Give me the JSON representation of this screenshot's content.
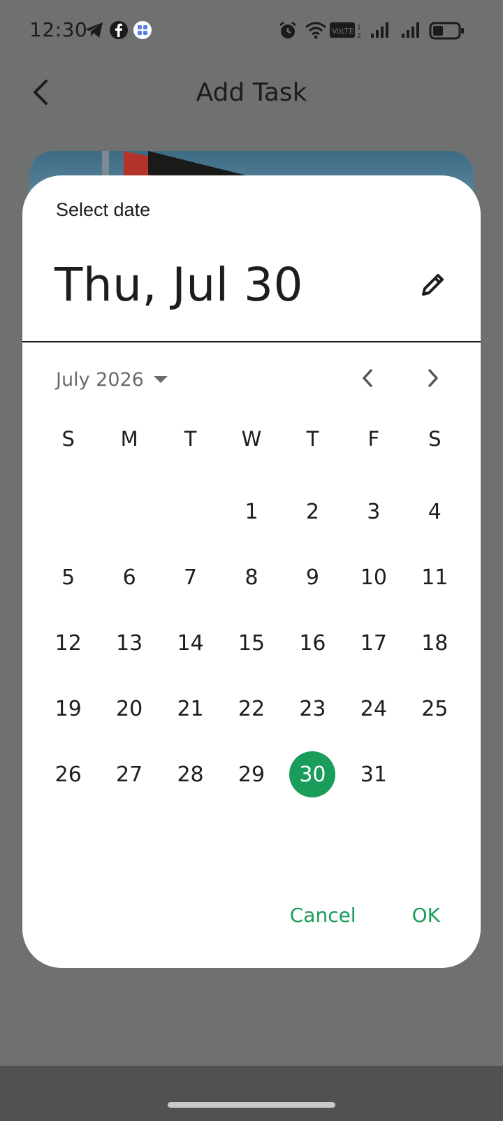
{
  "status_bar": {
    "time": "12:30",
    "icons": [
      "telegram-icon",
      "facebook-icon",
      "app-grid-icon",
      "alarm-icon",
      "wifi-icon",
      "volte-icon",
      "signal-icon",
      "signal-icon",
      "battery-icon"
    ]
  },
  "app_header": {
    "title": "Add Task",
    "back_icon": "chevron-left-icon"
  },
  "date_picker": {
    "headline_label": "Select date",
    "selected_date": "Thu, Jul 30",
    "edit_icon": "pencil-icon",
    "month_year": "July 2026",
    "weekdays": [
      "S",
      "M",
      "T",
      "W",
      "T",
      "F",
      "S"
    ],
    "leading_blanks": 3,
    "days": [
      "1",
      "2",
      "3",
      "4",
      "5",
      "6",
      "7",
      "8",
      "9",
      "10",
      "11",
      "12",
      "13",
      "14",
      "15",
      "16",
      "17",
      "18",
      "19",
      "20",
      "21",
      "22",
      "23",
      "24",
      "25",
      "26",
      "27",
      "28",
      "29",
      "30",
      "31"
    ],
    "selected_day": "30",
    "cancel_label": "Cancel",
    "ok_label": "OK"
  },
  "colors": {
    "accent": "#1a9c5b",
    "scrim": "#6f7171",
    "surface": "#ffffff"
  }
}
